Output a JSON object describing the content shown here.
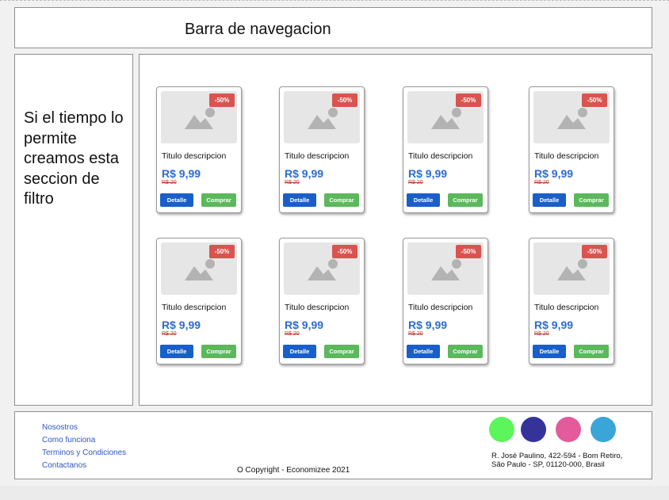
{
  "navbar": {
    "title": "Barra de navegacion"
  },
  "filter": {
    "text": "Si el tiempo lo permite creamos esta seccion de filtro"
  },
  "products": [
    {
      "discount": "-50%",
      "title": "Titulo descripcion",
      "price": "R$ 9,99",
      "old_price": "R$ 20",
      "detail_label": "Detalle",
      "buy_label": "Comprar"
    },
    {
      "discount": "-50%",
      "title": "Titulo descripcion",
      "price": "R$ 9,99",
      "old_price": "R$ 20",
      "detail_label": "Detalle",
      "buy_label": "Comprar"
    },
    {
      "discount": "-50%",
      "title": "Titulo descripcion",
      "price": "R$ 9,99",
      "old_price": "R$ 20",
      "detail_label": "Detalle",
      "buy_label": "Comprar"
    },
    {
      "discount": "-50%",
      "title": "Titulo descripcion",
      "price": "R$ 9,99",
      "old_price": "R$ 20",
      "detail_label": "Detalle",
      "buy_label": "Comprar"
    },
    {
      "discount": "-50%",
      "title": "Titulo descripcion",
      "price": "R$ 9,99",
      "old_price": "R$ 20",
      "detail_label": "Detalle",
      "buy_label": "Comprar"
    },
    {
      "discount": "-50%",
      "title": "Titulo descripcion",
      "price": "R$ 9,99",
      "old_price": "R$ 20",
      "detail_label": "Detalle",
      "buy_label": "Comprar"
    },
    {
      "discount": "-50%",
      "title": "Titulo descripcion",
      "price": "R$ 9,99",
      "old_price": "R$ 20",
      "detail_label": "Detalle",
      "buy_label": "Comprar"
    },
    {
      "discount": "-50%",
      "title": "Titulo descripcion",
      "price": "R$ 9,99",
      "old_price": "R$ 20",
      "detail_label": "Detalle",
      "buy_label": "Comprar"
    }
  ],
  "footer": {
    "links": [
      "Nosostros",
      "Como funciona",
      "Terminos y Condiciones",
      "Contactanos"
    ],
    "copyright": "O Copyright -  Economizee 2021",
    "address_line1": "R. José Paulino, 422-594 - Bom Retiro,",
    "address_line2": "São Paulo - SP, 01120-000, Brasil",
    "social_colors": [
      "#5cf55c",
      "#35339a",
      "#e35b9a",
      "#3aa6d8"
    ]
  },
  "colors": {
    "badge": "#d9534f",
    "price": "#2d6bd1",
    "detail_button": "#1a5fc9",
    "buy_button": "#5cb85c",
    "old_price": "#c0392b",
    "link": "#2c57c4"
  }
}
